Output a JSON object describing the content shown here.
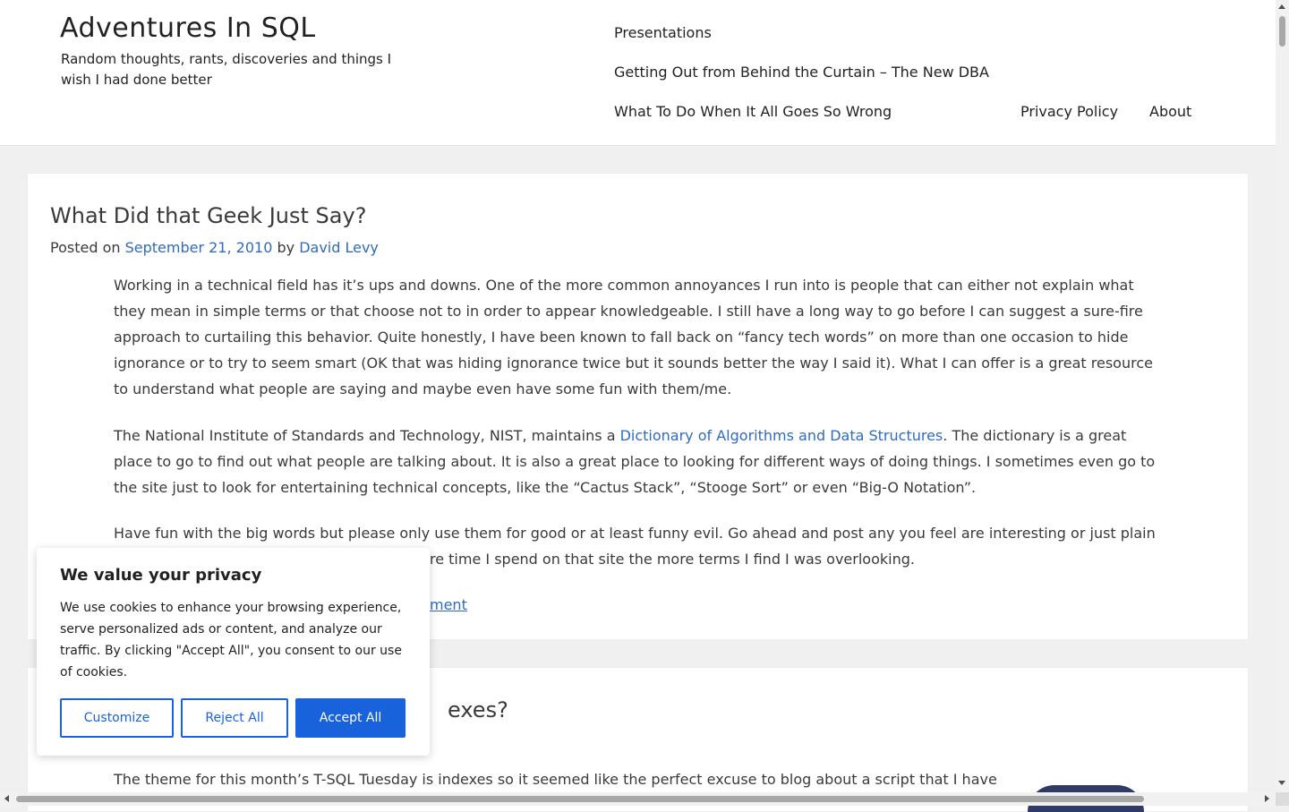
{
  "site": {
    "title": "Adventures In SQL",
    "description": "Random thoughts, rants, discoveries and things I wish I had done better"
  },
  "nav": {
    "items": [
      "Presentations",
      "Getting Out from Behind the Curtain – The New DBA",
      "What To Do When It All Goes So Wrong",
      "Privacy Policy",
      "About"
    ]
  },
  "post1": {
    "title": "What Did that Geek Just Say?",
    "meta": {
      "posted_on": "Posted on",
      "date": "September 21, 2010",
      "by": "by",
      "author": "David Levy"
    },
    "p1": "Working in a technical field has it’s ups and downs. One of the more common annoyances I run into is people that can either not explain what they mean in simple terms or that choose not to in order to appear knowledgeable. I still have a long way to go before I can suggest a sure-fire approach to curtailing this behavior. Quite honestly, I have been known to fall back on “fancy tech words” on more than one occasion to hide ignorance or to try to seem smart (OK that was hiding ignorance twice but it sounds better the way I said it). What I can offer is a great resource to understand what people are saying and maybe even have some fun with them/me.",
    "p2_before": "The National Institute of Standards and Technology, NIST, maintains a ",
    "p2_link": "Dictionary of Algorithms and Data Structures",
    "p2_after": ". The dictionary is a great place to go to find out what people are talking about. It is also a great place to looking for different ways of doing things. I sometimes even go to the site just to look for entertaining technical concepts, like the “Cactus Stack”, “Stooge Sort” or even “Big-O Notation”.",
    "p3_line1": "Have fun with the big words but please only use them for good or at least funny evil. Go ahead and post any you feel are interesting or just plain",
    "p3_line2": "re time I spend on that site the more terms I find I was overlooking.",
    "comment_link": "ment"
  },
  "post2": {
    "title_partial": "exes?",
    "p1_line1": "The theme for this month’s T-SQL Tuesday is indexes so it seemed like the perfect excuse to blog about a script that I have"
  },
  "cookie": {
    "title": "We value your privacy",
    "text": "We use cookies to enhance your browsing experience, serve personalized ads or content, and analyze our traffic. By clicking \"Accept All\", you consent to our use of cookies.",
    "customize": "Customize",
    "reject": "Reject All",
    "accept": "Accept All"
  },
  "colors": {
    "link": "#2f6bc0",
    "cookie_accent": "#1863dc"
  }
}
